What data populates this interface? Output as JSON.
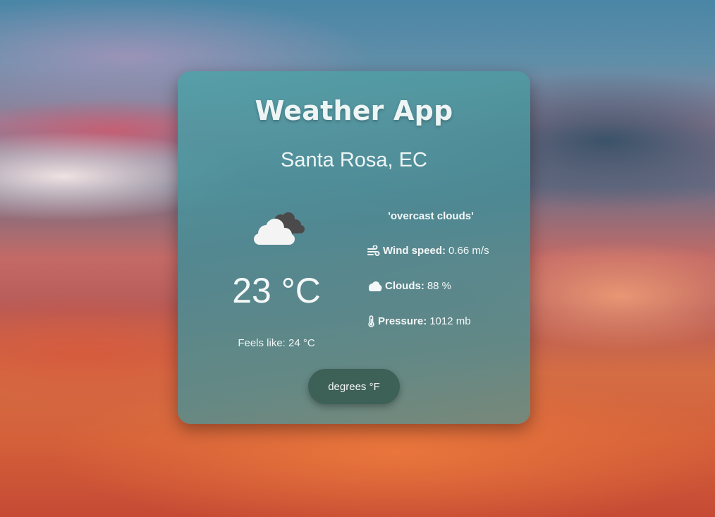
{
  "app": {
    "title": "Weather App"
  },
  "location": {
    "city": "Santa Rosa, EC"
  },
  "weather": {
    "icon": "overcast-clouds-icon",
    "temperature": "23 °C",
    "feels_like": "Feels like: 24 °C",
    "description": "'overcast clouds'",
    "wind": {
      "icon": "wind-icon",
      "label": "Wind speed:",
      "value": "0.66 m/s"
    },
    "clouds": {
      "icon": "cloud-icon",
      "label": "Clouds:",
      "value": "88 %"
    },
    "pressure": {
      "icon": "thermometer-icon",
      "label": "Pressure:",
      "value": "1012 mb"
    }
  },
  "controls": {
    "unit_toggle_label": "degrees °F"
  },
  "colors": {
    "card_tint": "#4f9aa3",
    "button_bg": "#3d6057",
    "text": "#f2f6f6"
  }
}
